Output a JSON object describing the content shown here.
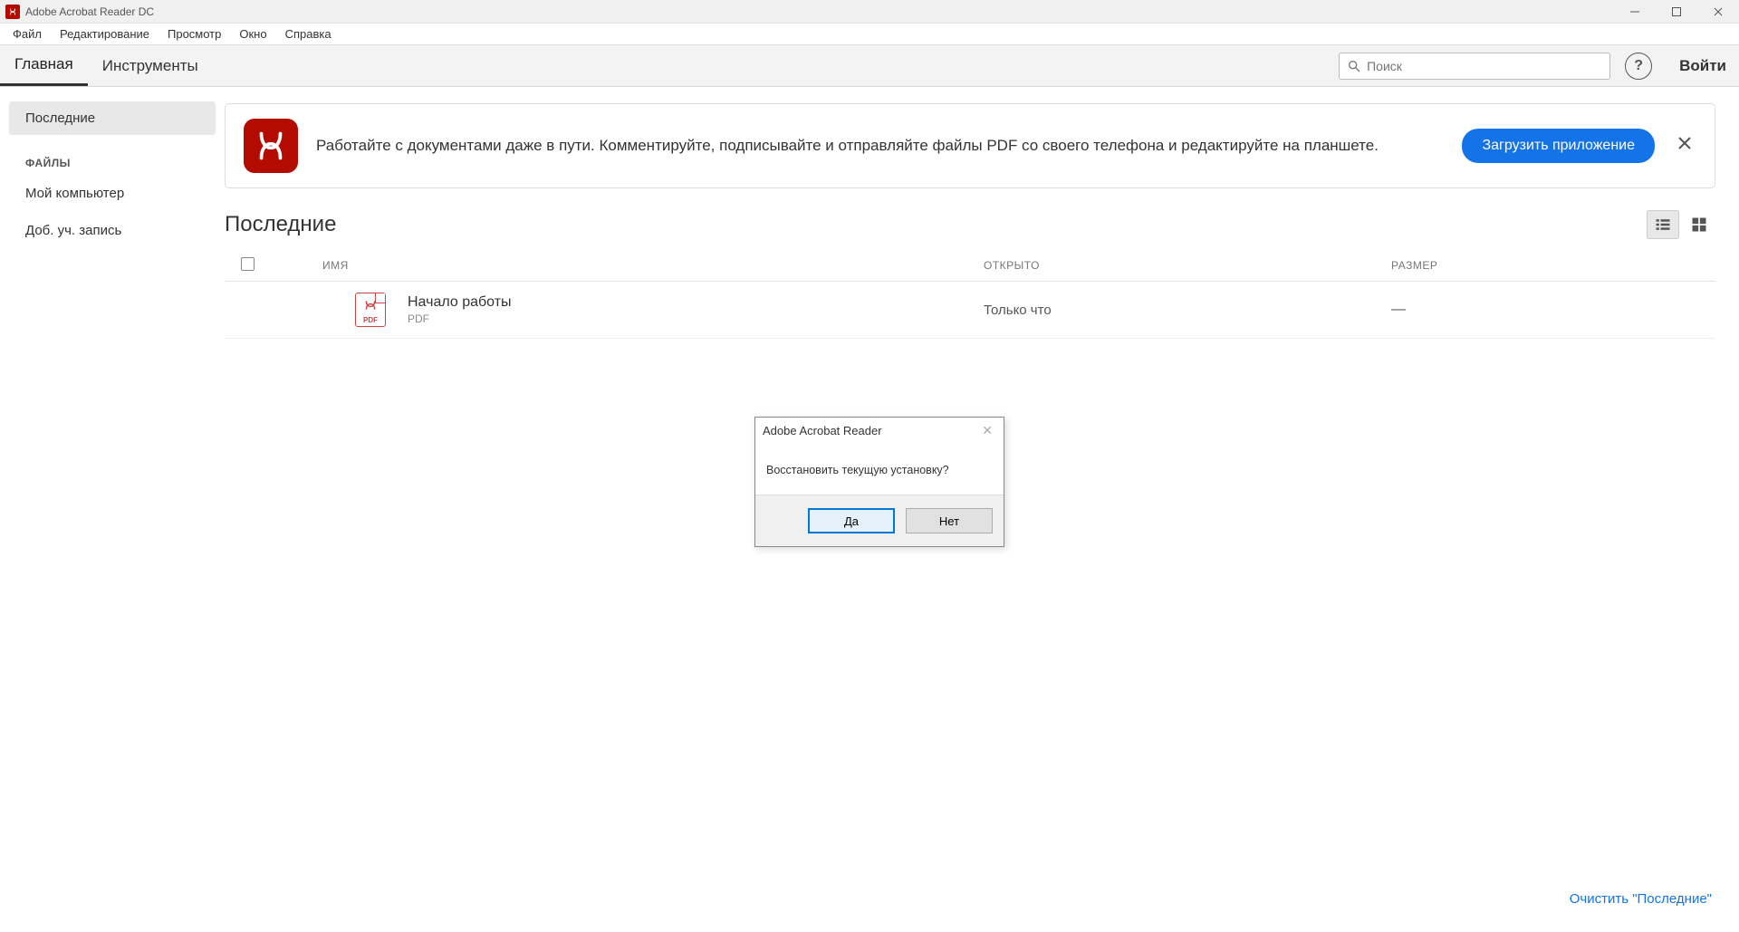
{
  "window": {
    "title": "Adobe Acrobat Reader DC"
  },
  "menu": {
    "file": "Файл",
    "edit": "Редактирование",
    "view": "Просмотр",
    "window": "Окно",
    "help": "Справка"
  },
  "topbar": {
    "tab_home": "Главная",
    "tab_tools": "Инструменты",
    "search_placeholder": "Поиск",
    "help_glyph": "?",
    "signin": "Войти"
  },
  "sidebar": {
    "recent": "Последние",
    "files_heading": "ФАЙЛЫ",
    "my_computer": "Мой компьютер",
    "add_account": "Доб. уч. запись"
  },
  "banner": {
    "text": "Работайте с документами даже в пути. Комментируйте, подписывайте и отправляйте файлы PDF со своего телефона и редактируйте на планшете.",
    "button": "Загрузить приложение"
  },
  "section": {
    "title": "Последние"
  },
  "table": {
    "headers": {
      "name": "ИМЯ",
      "opened": "ОТКРЫТО",
      "size": "РАЗМЕР"
    },
    "rows": [
      {
        "name": "Начало работы",
        "type": "PDF",
        "opened": "Только что",
        "size": "—",
        "ext": "PDF"
      }
    ]
  },
  "footer": {
    "clear_recent": "Очистить \"Последние\""
  },
  "dialog": {
    "title": "Adobe Acrobat Reader",
    "message": "Восстановить текущую установку?",
    "yes": "Да",
    "no": "Нет"
  }
}
